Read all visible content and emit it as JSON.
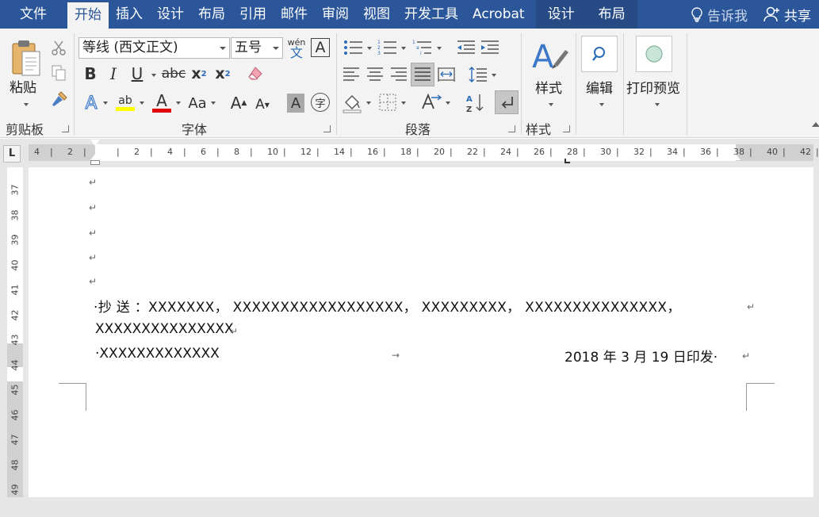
{
  "menubar": {
    "tabs": [
      {
        "label": "文件"
      },
      {
        "label": "开始"
      },
      {
        "label": "插入"
      },
      {
        "label": "设计"
      },
      {
        "label": "布局"
      },
      {
        "label": "引用"
      },
      {
        "label": "邮件"
      },
      {
        "label": "审阅"
      },
      {
        "label": "视图"
      },
      {
        "label": "开发工具"
      },
      {
        "label": "Acrobat"
      },
      {
        "label": "设计"
      },
      {
        "label": "布局"
      }
    ],
    "tell_me": "告诉我",
    "share": "共享"
  },
  "ribbon": {
    "clipboard": {
      "paste": "粘贴",
      "label": "剪贴板"
    },
    "font": {
      "name": "等线 (西文正文)",
      "size": "五号",
      "phonetic_top": "wén",
      "phonetic_bottom": "文",
      "border_char": "A",
      "bold": "B",
      "italic": "I",
      "underline": "U",
      "strike": "abc",
      "subscript": "x",
      "sub_mark": "2",
      "superscript": "x",
      "sup_mark": "2",
      "text_effect": "A",
      "font_color": "A",
      "change_case": "Aa",
      "grow": "A",
      "shrink": "A",
      "char_shade": "A",
      "enclose": "字",
      "highlight": "ab",
      "label": "字体"
    },
    "paragraph": {
      "label": "段落"
    },
    "styles": {
      "label": "样式",
      "button": "样式"
    },
    "editing": {
      "button": "编辑"
    },
    "print_preview": {
      "button": "打印预览"
    }
  },
  "ruler": {
    "corner": "L",
    "ticks": [
      "4",
      "2",
      "",
      "2",
      "4",
      "6",
      "8",
      "10",
      "12",
      "14",
      "16",
      "18",
      "20",
      "22",
      "24",
      "26",
      "28",
      "30",
      "32",
      "34",
      "36",
      "38",
      "40",
      "42"
    ]
  },
  "vruler": {
    "nums": [
      "37",
      "38",
      "39",
      "40",
      "41",
      "42",
      "43",
      "44",
      "45",
      "46",
      "47",
      "48",
      "49"
    ]
  },
  "document": {
    "line1": "·抄 送 ：XXXXXXX，  XXXXXXXXXXXXXXXXXX，  XXXXXXXXX，  XXXXXXXXXXXXXXX，",
    "line2": "XXXXXXXXXXXXXXX",
    "line3_left": "·XXXXXXXXXXXXX",
    "line3_right": "2018 年 3 月 19 日印发·",
    "para_mark": "↵",
    "tab_mark": "→"
  }
}
